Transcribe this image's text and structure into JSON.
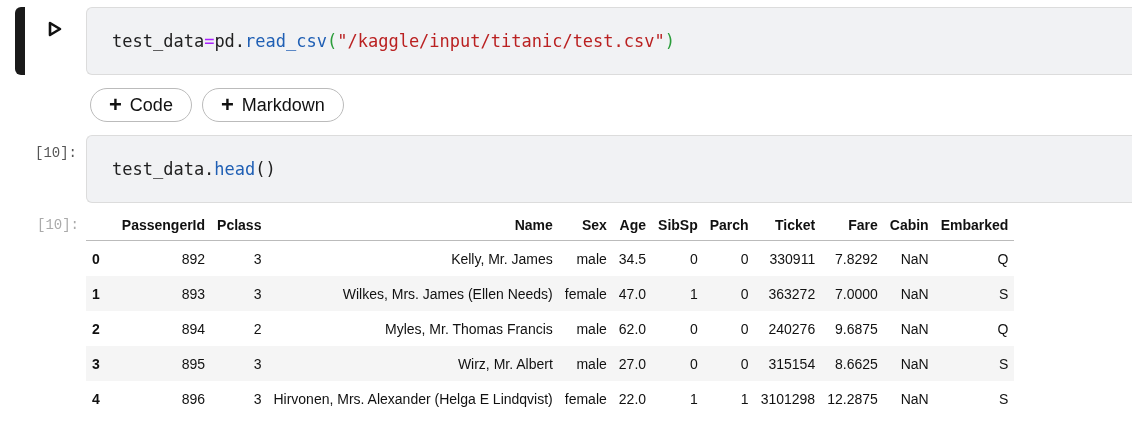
{
  "cells": [
    {
      "kind": "code",
      "selected": true,
      "tokens": [
        {
          "kind": "plain",
          "text": "test_data"
        },
        {
          "kind": "op",
          "text": "="
        },
        {
          "kind": "plain",
          "text": "pd."
        },
        {
          "kind": "fn",
          "text": "read_csv"
        },
        {
          "kind": "paren",
          "text": "("
        },
        {
          "kind": "string",
          "text": "\"/kaggle/input/titanic/test.csv\""
        },
        {
          "kind": "paren",
          "text": ")"
        }
      ]
    },
    {
      "kind": "add_buttons",
      "buttons": [
        {
          "icon": "+",
          "label": "Code"
        },
        {
          "icon": "+",
          "label": "Markdown"
        }
      ]
    },
    {
      "kind": "code",
      "selected": false,
      "prompt": "[10]:",
      "tokens": [
        {
          "kind": "plain",
          "text": "test_data."
        },
        {
          "kind": "fn",
          "text": "head"
        },
        {
          "kind": "plain",
          "text": "()"
        }
      ]
    },
    {
      "kind": "output",
      "prompt": "[10]:",
      "table": {
        "columns": [
          "",
          "PassengerId",
          "Pclass",
          "Name",
          "Sex",
          "Age",
          "SibSp",
          "Parch",
          "Ticket",
          "Fare",
          "Cabin",
          "Embarked"
        ],
        "rows": [
          [
            "0",
            "892",
            "3",
            "Kelly, Mr. James",
            "male",
            "34.5",
            "0",
            "0",
            "330911",
            "7.8292",
            "NaN",
            "Q"
          ],
          [
            "1",
            "893",
            "3",
            "Wilkes, Mrs. James (Ellen Needs)",
            "female",
            "47.0",
            "1",
            "0",
            "363272",
            "7.0000",
            "NaN",
            "S"
          ],
          [
            "2",
            "894",
            "2",
            "Myles, Mr. Thomas Francis",
            "male",
            "62.0",
            "0",
            "0",
            "240276",
            "9.6875",
            "NaN",
            "Q"
          ],
          [
            "3",
            "895",
            "3",
            "Wirz, Mr. Albert",
            "male",
            "27.0",
            "0",
            "0",
            "315154",
            "8.6625",
            "NaN",
            "S"
          ],
          [
            "4",
            "896",
            "3",
            "Hirvonen, Mrs. Alexander (Helga E Lindqvist)",
            "female",
            "22.0",
            "1",
            "1",
            "3101298",
            "12.2875",
            "NaN",
            "S"
          ]
        ]
      }
    }
  ]
}
